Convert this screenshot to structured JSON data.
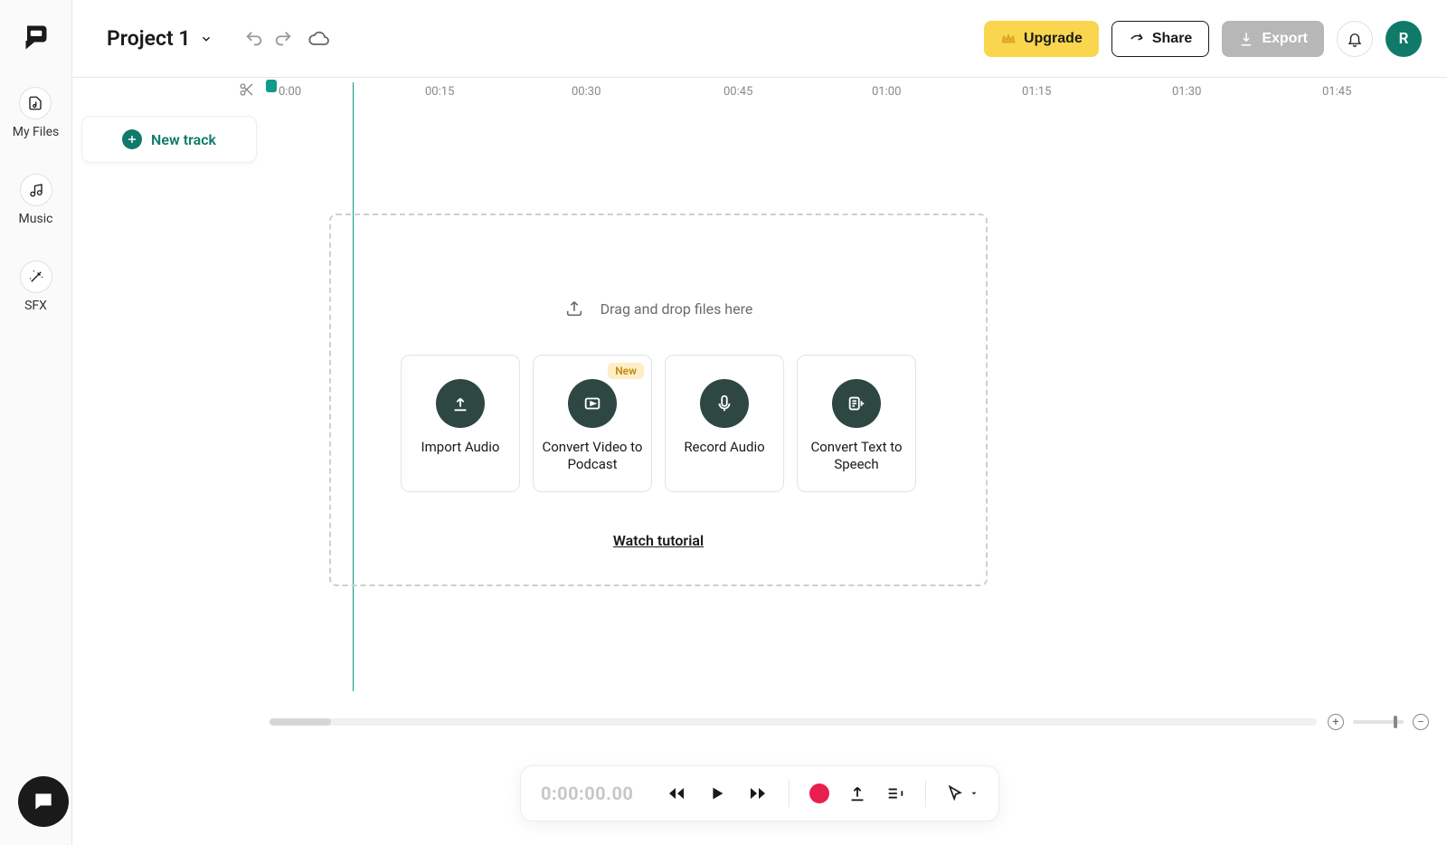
{
  "header": {
    "project_title": "Project 1",
    "upgrade_label": "Upgrade",
    "share_label": "Share",
    "export_label": "Export",
    "avatar_initial": "R"
  },
  "sidebar": {
    "items": [
      {
        "label": "My Files"
      },
      {
        "label": "Music"
      },
      {
        "label": "SFX"
      }
    ]
  },
  "timeline": {
    "new_track_label": "New track",
    "ruler_labels": [
      "0:00",
      "00:15",
      "00:30",
      "00:45",
      "01:00",
      "01:15",
      "01:30",
      "01:45"
    ],
    "playhead_time": "0:00"
  },
  "dropzone": {
    "hint": "Drag and drop files here",
    "tutorial_label": "Watch tutorial",
    "new_badge": "New",
    "cards": [
      {
        "label": "Import Audio",
        "badge": false
      },
      {
        "label": "Convert Video to Podcast",
        "badge": true
      },
      {
        "label": "Record Audio",
        "badge": false
      },
      {
        "label": "Convert Text to Speech",
        "badge": false
      }
    ]
  },
  "player": {
    "timecode": "0:00:00.00"
  }
}
